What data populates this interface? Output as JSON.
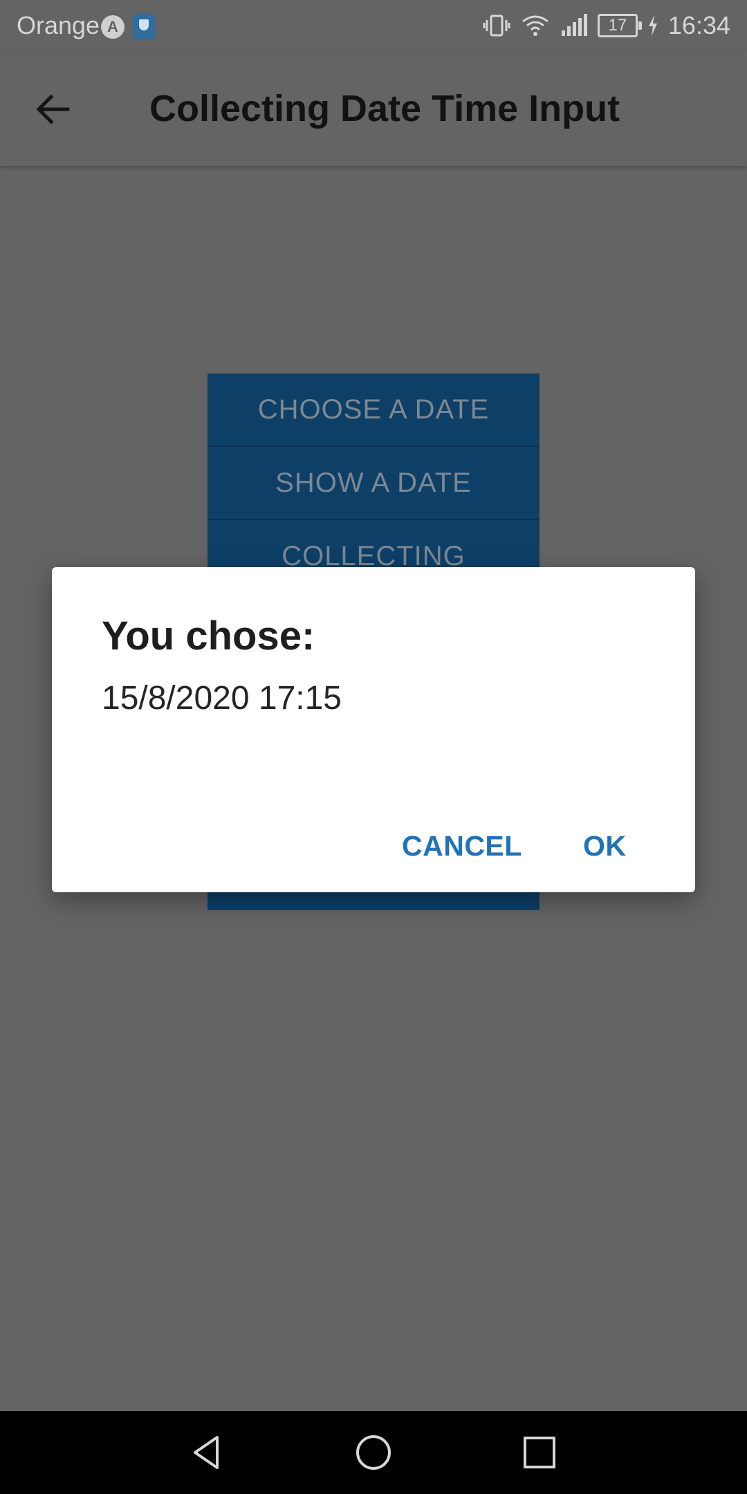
{
  "status_bar": {
    "carrier": "Orange",
    "battery_level": "17",
    "time": "16:34"
  },
  "app_bar": {
    "title": "Collecting Date Time Input"
  },
  "background_buttons": [
    {
      "label": "CHOOSE A DATE"
    },
    {
      "label": "SHOW A DATE"
    },
    {
      "label": "COLLECTING"
    }
  ],
  "dialog": {
    "title": "You chose:",
    "message": "15/8/2020 17:15",
    "cancel_label": "CANCEL",
    "ok_label": "OK"
  },
  "colors": {
    "scrim": "#646464",
    "button_bg": "#0e3f67",
    "dialog_action": "#1f73b7"
  },
  "icons": {
    "back": "arrow-left-icon",
    "nav_back": "triangle-back-icon",
    "nav_home": "circle-home-icon",
    "nav_recent": "square-recent-icon"
  }
}
